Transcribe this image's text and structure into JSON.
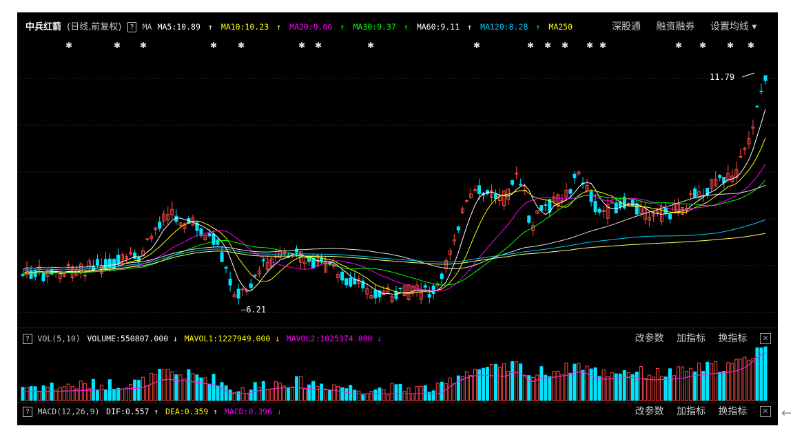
{
  "stock": {
    "name": "中兵红箭",
    "mode": "(日线,前复权)",
    "help": "?",
    "ma_label": "MA"
  },
  "ma": [
    {
      "label": "MA5:10.89",
      "color": "#ffffff",
      "arrow": "↑"
    },
    {
      "label": "MA10:10.23",
      "color": "#ffff00",
      "arrow": "↑"
    },
    {
      "label": "MA20:9.66",
      "color": "#ff00ff",
      "arrow": "↑"
    },
    {
      "label": "MA30:9.37",
      "color": "#00ff00",
      "arrow": "↑"
    },
    {
      "label": "MA60:9.11",
      "color": "#ffffff",
      "arrow": "↑"
    },
    {
      "label": "MA120:8.28",
      "color": "#00ccff",
      "arrow": "↑"
    },
    {
      "label": "MA250",
      "color": "#ffff00",
      "arrow": ""
    }
  ],
  "top_links": [
    "深股通",
    "融资融券",
    "设置均线 ▾"
  ],
  "markers": {
    "high_label": "11.79",
    "low_label": "6.21",
    "dollar": "$"
  },
  "vol": {
    "help": "?",
    "name": "VOL(5,10)",
    "volume": "VOLUME:550807.000",
    "volume_arrow": "↓",
    "mavol1": "MAVOL1:1227949.000",
    "mavol1_arrow": "↓",
    "mavol2": "MAVOL2:1025374.800",
    "mavol2_arrow": "↓",
    "links": [
      "改参数",
      "加指标",
      "换指标"
    ],
    "close": "✕"
  },
  "macd": {
    "help": "?",
    "name": "MACD(12,26,9)",
    "dif": "DIF:0.557",
    "dif_arrow": "↑",
    "dea": "DEA:0.359",
    "dea_arrow": "↑",
    "macd": "MACD:0.396",
    "macd_arrow": "↓",
    "links": [
      "改参数",
      "加指标",
      "换指标"
    ],
    "close": "✕"
  },
  "outside_arrow": "←",
  "colors": {
    "up": "#ff4a4a",
    "down": "#00e5ff",
    "ma5": "#ffffff",
    "ma10": "#ffff00",
    "ma20": "#ff00ff",
    "ma30": "#00ff00",
    "ma60": "#e0e0e0",
    "ma120": "#00ccff",
    "ma250": "#ffff66"
  }
}
